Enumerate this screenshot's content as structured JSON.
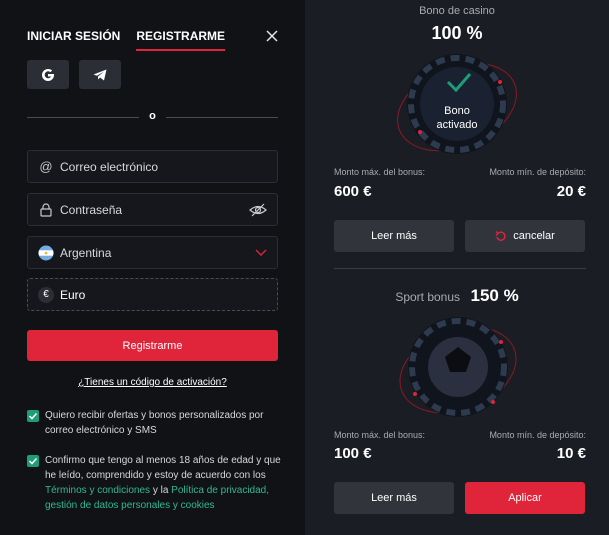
{
  "auth": {
    "tab_login": "INICIAR SESIÓN",
    "tab_register": "REGISTRARME",
    "divider": "o",
    "email_placeholder": "Correo electrónico",
    "password_placeholder": "Contraseña",
    "country": "Argentina",
    "currency": "Euro",
    "currency_symbol": "€",
    "register_button": "Registrarme",
    "activation_link": "¿Tienes un código de activación?",
    "consent_offers": "Quiero recibir ofertas y bonos personalizados por correo electrónico y SMS",
    "consent_terms_prefix": "Confirmo que tengo al menos 18 años de edad y que he leído, comprendido y estoy de acuerdo con los",
    "consent_terms_link": "Términos y condiciones",
    "consent_terms_mid": "y la",
    "consent_privacy_link": "Política de privacidad, gestión de datos personales y cookies"
  },
  "bonus_casino": {
    "title": "Bono de casino",
    "percent": "100 %",
    "badge_line1": "Bono",
    "badge_line2": "activado",
    "max_bonus_label": "Monto máx. del bonus:",
    "max_bonus_value": "600 €",
    "min_deposit_label": "Monto mín. de depósito:",
    "min_deposit_value": "20 €",
    "more_button": "Leer más",
    "cancel_button": "cancelar"
  },
  "bonus_sport": {
    "title": "Sport bonus",
    "percent": "150 %",
    "max_bonus_label": "Monto máx. del bonus:",
    "max_bonus_value": "100 €",
    "min_deposit_label": "Monto mín. de depósito:",
    "min_deposit_value": "10 €",
    "more_button": "Leer más",
    "apply_button": "Aplicar"
  },
  "colors": {
    "accent_red": "#e0243a",
    "check_green": "#1e9c77",
    "link_green": "#2fb98e"
  }
}
